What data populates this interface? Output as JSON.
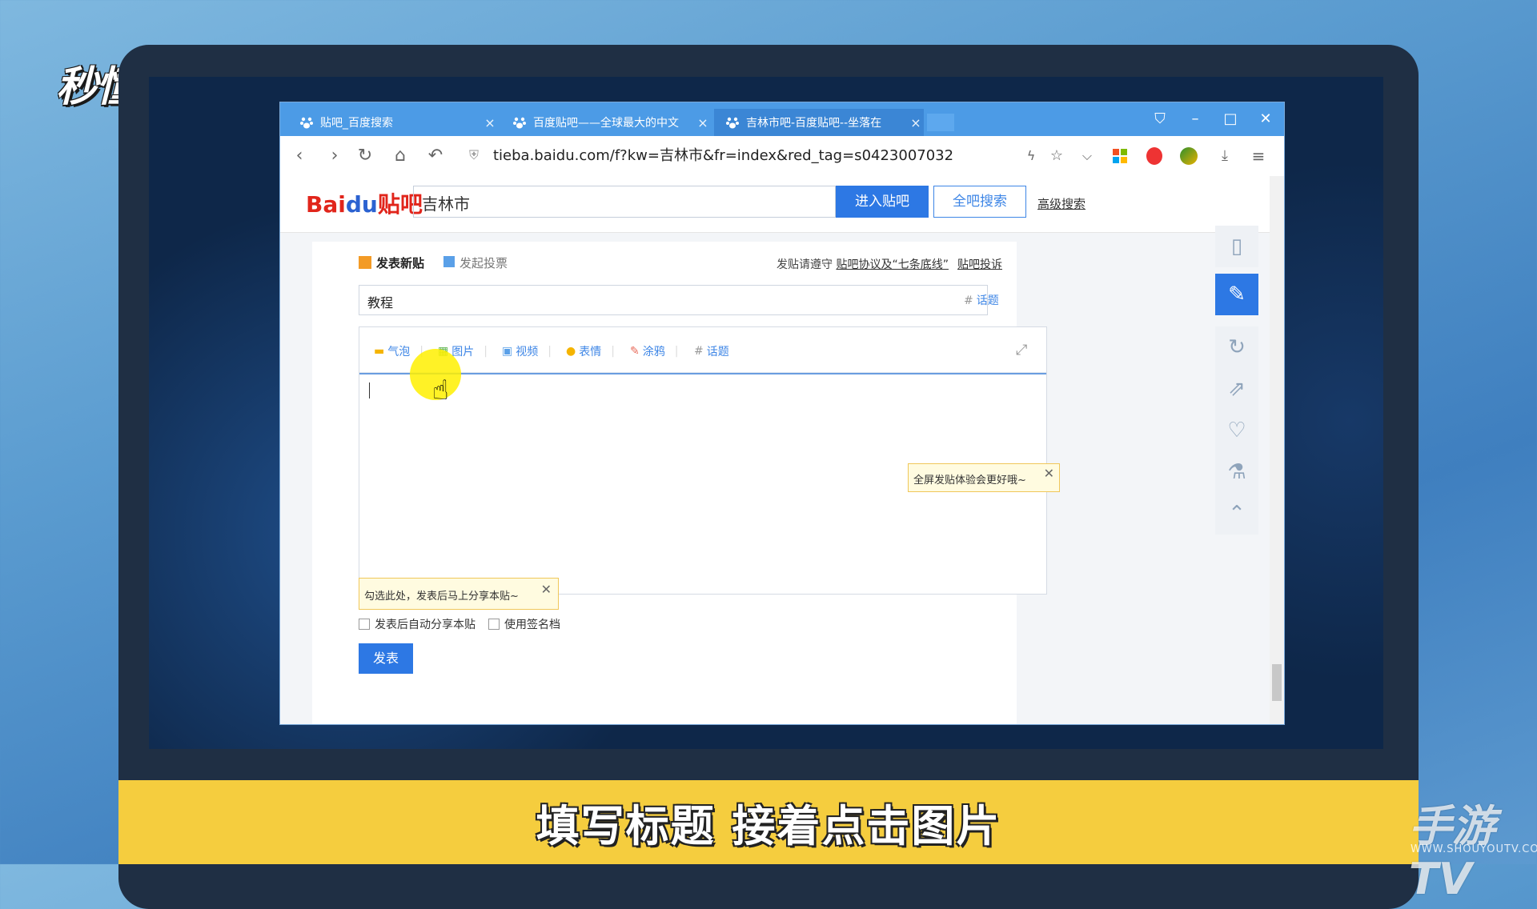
{
  "watermark": {
    "logo": "秒懂视频",
    "right": "手游TV",
    "right_sub": "WWW.SHOUYOUTV.COM"
  },
  "caption": "填写标题 接着点击图片",
  "browser": {
    "tabs": [
      {
        "label": "贴吧_百度搜索"
      },
      {
        "label": "百度贴吧——全球最大的中文"
      },
      {
        "label": "吉林市吧-百度贴吧--坐落在"
      }
    ],
    "url": "tieba.baidu.com/f?kw=吉林市&fr=index&red_tag=s0423007032"
  },
  "header": {
    "logo_bai": "Bai",
    "logo_du": "du",
    "logo_tieba": "贴吧",
    "search_value": "吉林市",
    "enter_button": "进入贴吧",
    "search_all_button": "全吧搜索",
    "advanced_search": "高级搜索"
  },
  "post": {
    "new_post": "发表新贴",
    "start_vote": "发起投票",
    "rules_prefix": "发贴请遵守",
    "rules_link": "贴吧协议及“七条底线”",
    "report": "贴吧投诉",
    "title_value": "教程",
    "topic": "话题",
    "tools": [
      "气泡",
      "图片",
      "视频",
      "表情",
      "涂鸦",
      "话题"
    ],
    "tip_fullscreen": "全屏发贴体验会更好哦~",
    "tip_share": "勾选此处，发表后马上分享本贴~",
    "checkbox_share": "发表后自动分享本贴",
    "checkbox_signature": "使用签名档",
    "submit": "发表"
  }
}
